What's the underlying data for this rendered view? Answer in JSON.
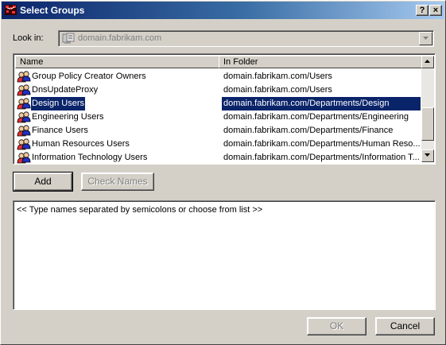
{
  "window": {
    "title": "Select Groups",
    "help_label": "?",
    "close_label": "×"
  },
  "lookin": {
    "label": "Look in:",
    "value": "domain.fabrikam.com"
  },
  "list": {
    "columns": [
      "Name",
      "In Folder"
    ],
    "rows": [
      {
        "name": "Group Policy Creator Owners",
        "folder": "domain.fabrikam.com/Users",
        "selected": false
      },
      {
        "name": "DnsUpdateProxy",
        "folder": "domain.fabrikam.com/Users",
        "selected": false
      },
      {
        "name": "Design Users",
        "folder": "domain.fabrikam.com/Departments/Design",
        "selected": true
      },
      {
        "name": "Engineering Users",
        "folder": "domain.fabrikam.com/Departments/Engineering",
        "selected": false
      },
      {
        "name": "Finance Users",
        "folder": "domain.fabrikam.com/Departments/Finance",
        "selected": false
      },
      {
        "name": "Human Resources Users",
        "folder": "domain.fabrikam.com/Departments/Human Reso...",
        "selected": false
      },
      {
        "name": "Information Technology Users",
        "folder": "domain.fabrikam.com/Departments/Information T...",
        "selected": false
      }
    ],
    "row_icon": "group-icon"
  },
  "buttons": {
    "add": "Add",
    "check_names": "Check Names",
    "ok": "OK",
    "cancel": "Cancel"
  },
  "names_input": {
    "placeholder": "<< Type names separated by semicolons or choose from list >>"
  },
  "colors": {
    "title_gradient_start": "#0a246a",
    "title_gradient_end": "#a6caf0",
    "selection": "#0a246a",
    "face": "#d4d0c8"
  }
}
